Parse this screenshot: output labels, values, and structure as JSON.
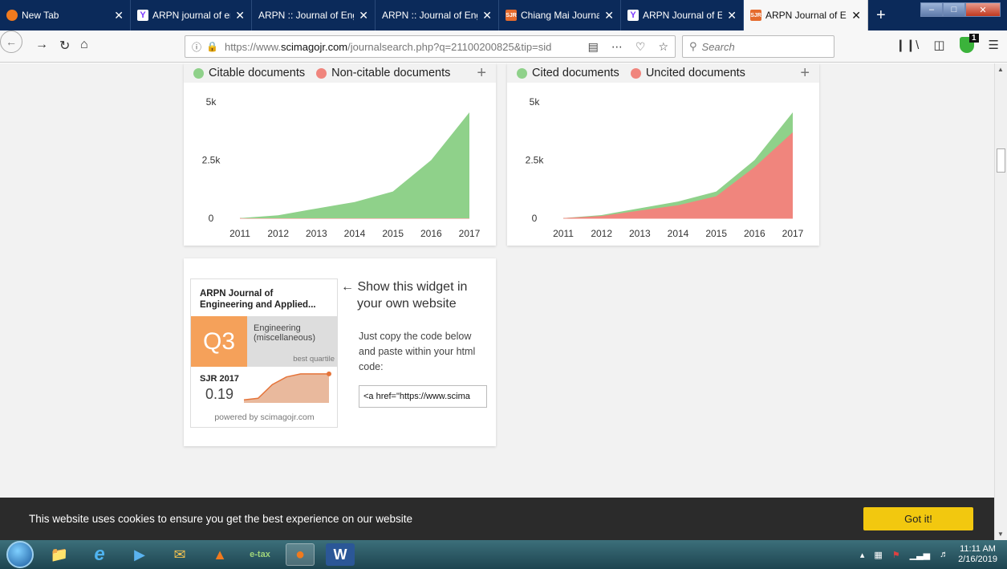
{
  "browser": {
    "tabs": [
      {
        "title": "New Tab",
        "icon": "firefox-icon",
        "active": false
      },
      {
        "title": "ARPN journal of eng",
        "icon": "yahoo-icon",
        "active": false
      },
      {
        "title": "ARPN :: Journal of Engine",
        "icon": "none",
        "active": false
      },
      {
        "title": "ARPN :: Journal of Engine",
        "icon": "none",
        "active": false
      },
      {
        "title": "Chiang Mai Journal o",
        "icon": "sjr-icon",
        "active": false
      },
      {
        "title": "ARPN Journal of Eng",
        "icon": "yahoo-icon",
        "active": false
      },
      {
        "title": "ARPN Journal of Eng",
        "icon": "sjr-icon",
        "active": true
      }
    ],
    "url_prefix": "https://www.",
    "url_domain": "scimagojr.com",
    "url_path": "/journalsearch.php?q=21100200825&tip=sid",
    "search_placeholder": "Search",
    "shield_badge": "1"
  },
  "charts": {
    "citable": {
      "legend": [
        {
          "label": "Citable documents",
          "color": "#8fd18a"
        },
        {
          "label": "Non-citable documents",
          "color": "#f0857d"
        }
      ]
    },
    "cited": {
      "legend": [
        {
          "label": "Cited documents",
          "color": "#8fd18a"
        },
        {
          "label": "Uncited documents",
          "color": "#f0857d"
        }
      ]
    }
  },
  "chart_data": [
    {
      "type": "area",
      "x": [
        2011,
        2012,
        2013,
        2014,
        2015,
        2016,
        2017
      ],
      "series": [
        {
          "name": "Citable documents",
          "values": [
            10,
            130,
            420,
            700,
            1150,
            2500,
            4550
          ],
          "color": "#8fd18a"
        },
        {
          "name": "Non-citable documents",
          "values": [
            0,
            0,
            0,
            0,
            0,
            0,
            0
          ],
          "color": "#f0857d"
        }
      ],
      "yticks": [
        "0",
        "2.5k",
        "5k"
      ],
      "ylim": [
        0,
        5000
      ]
    },
    {
      "type": "area",
      "x": [
        2011,
        2012,
        2013,
        2014,
        2015,
        2016,
        2017
      ],
      "series": [
        {
          "name": "Uncited documents",
          "values": [
            10,
            100,
            330,
            560,
            950,
            2200,
            3700
          ],
          "color": "#f0857d"
        },
        {
          "name": "Cited documents",
          "values": [
            10,
            140,
            430,
            720,
            1150,
            2500,
            4550
          ],
          "color": "#8fd18a"
        }
      ],
      "yticks": [
        "0",
        "2.5k",
        "5k"
      ],
      "ylim": [
        0,
        5000
      ]
    }
  ],
  "widget": {
    "journal_title_line1": "ARPN Journal of",
    "journal_title_line2": "Engineering and Applied...",
    "quartile": "Q3",
    "category_line1": "Engineering",
    "category_line2": "(miscellaneous)",
    "best_quartile": "best quartile",
    "sjr_label": "SJR 2017",
    "sjr_value": "0.19",
    "sparkline": [
      0.02,
      0.03,
      0.12,
      0.17,
      0.19,
      0.19,
      0.19
    ],
    "powered": "powered by scimagojr.com",
    "show_line1": "← Show this widget in",
    "show_line2": "your own website",
    "copy_line1": "Just copy the code below",
    "copy_line2": "and paste within your html",
    "copy_line3": "code:",
    "code_value": "<a href=\"https://www.scima"
  },
  "cookie": {
    "text": "This website uses cookies to ensure you get the best experience on our website",
    "button": "Got it!"
  },
  "taskbar": {
    "time": "11:11 AM",
    "date": "2/16/2019"
  }
}
